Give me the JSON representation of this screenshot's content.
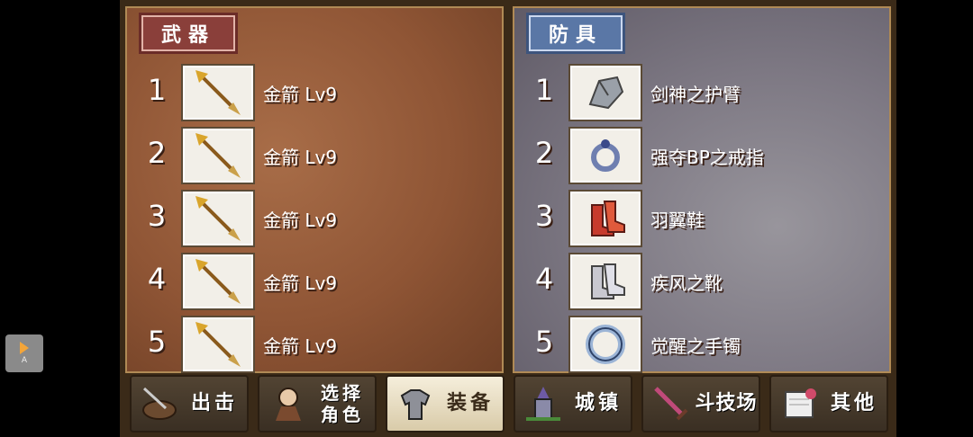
{
  "weapons": {
    "title": "武器",
    "items": [
      {
        "num": "1",
        "name": "金箭 Lv9",
        "icon": "golden-arrow-icon"
      },
      {
        "num": "2",
        "name": "金箭 Lv9",
        "icon": "golden-arrow-icon"
      },
      {
        "num": "3",
        "name": "金箭 Lv9",
        "icon": "golden-arrow-icon"
      },
      {
        "num": "4",
        "name": "金箭 Lv9",
        "icon": "golden-arrow-icon"
      },
      {
        "num": "5",
        "name": "金箭 Lv9",
        "icon": "golden-arrow-icon"
      }
    ]
  },
  "armor": {
    "title": "防具",
    "items": [
      {
        "num": "1",
        "name": "剑神之护臂",
        "icon": "gauntlet-icon"
      },
      {
        "num": "2",
        "name": "强夺BP之戒指",
        "icon": "ring-icon"
      },
      {
        "num": "3",
        "name": "羽翼鞋",
        "icon": "red-boots-icon"
      },
      {
        "num": "4",
        "name": "疾风之靴",
        "icon": "silver-boots-icon"
      },
      {
        "num": "5",
        "name": "觉醒之手镯",
        "icon": "bracelet-icon"
      }
    ]
  },
  "tabs": [
    {
      "label": "出击",
      "icon": "sortie-icon",
      "active": false
    },
    {
      "label": "选择角色",
      "line1": "选择",
      "line2": "角色",
      "icon": "character-icon",
      "active": false
    },
    {
      "label": "装备",
      "icon": "armor-icon",
      "active": true
    },
    {
      "label": "城镇",
      "icon": "town-icon",
      "active": false
    },
    {
      "label": "斗技场",
      "icon": "sword-icon",
      "active": false
    },
    {
      "label": "其他",
      "icon": "scroll-icon",
      "active": false
    }
  ],
  "overlay": {
    "label": "A",
    "icon": "play-icon"
  }
}
